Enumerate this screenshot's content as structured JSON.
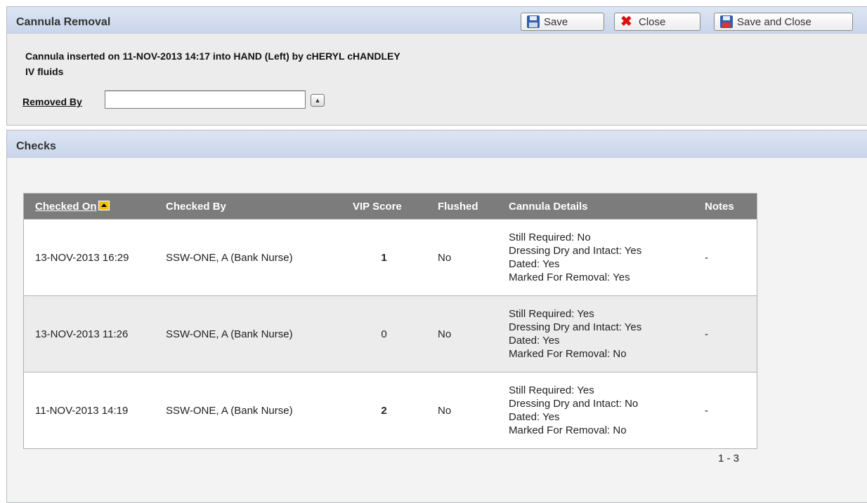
{
  "cannula_removal": {
    "title": "Cannula Removal",
    "buttons": {
      "save": "Save",
      "close": "Close",
      "save_and_close": "Save and Close"
    },
    "info_line": "Cannula inserted on 11-NOV-2013 14:17 into HAND (Left) by cHERYL cHANDLEY",
    "fluids_line": "IV fluids",
    "removed_by_label": "Removed By",
    "removed_by_value": ""
  },
  "checks": {
    "title": "Checks",
    "columns": [
      "Checked On",
      "Checked By",
      "VIP Score",
      "Flushed",
      "Cannula Details",
      "Notes"
    ],
    "rows": [
      {
        "checked_on": "13-NOV-2013 16:29",
        "checked_by": "SSW-ONE, A (Bank Nurse)",
        "vip_score": "1",
        "flushed": "No",
        "details": [
          "Still Required: No",
          "Dressing Dry and Intact: Yes",
          "Dated: Yes",
          "Marked For Removal: Yes"
        ],
        "notes": "-"
      },
      {
        "checked_on": "13-NOV-2013 11:26",
        "checked_by": "SSW-ONE, A (Bank Nurse)",
        "vip_score": "0",
        "flushed": "No",
        "details": [
          "Still Required: Yes",
          "Dressing Dry and Intact: Yes",
          "Dated: Yes",
          "Marked For Removal: No"
        ],
        "notes": "-"
      },
      {
        "checked_on": "11-NOV-2013 14:19",
        "checked_by": "SSW-ONE, A (Bank Nurse)",
        "vip_score": "2",
        "flushed": "No",
        "details": [
          "Still Required: Yes",
          "Dressing Dry and Intact: No",
          "Dated: Yes",
          "Marked For Removal: No"
        ],
        "notes": "-"
      }
    ],
    "pagination": "1 - 3"
  },
  "colors": {
    "score_highlight": "#dd0000",
    "header_bg": "#7c7c7c",
    "region_header": "#c9d5ea"
  }
}
